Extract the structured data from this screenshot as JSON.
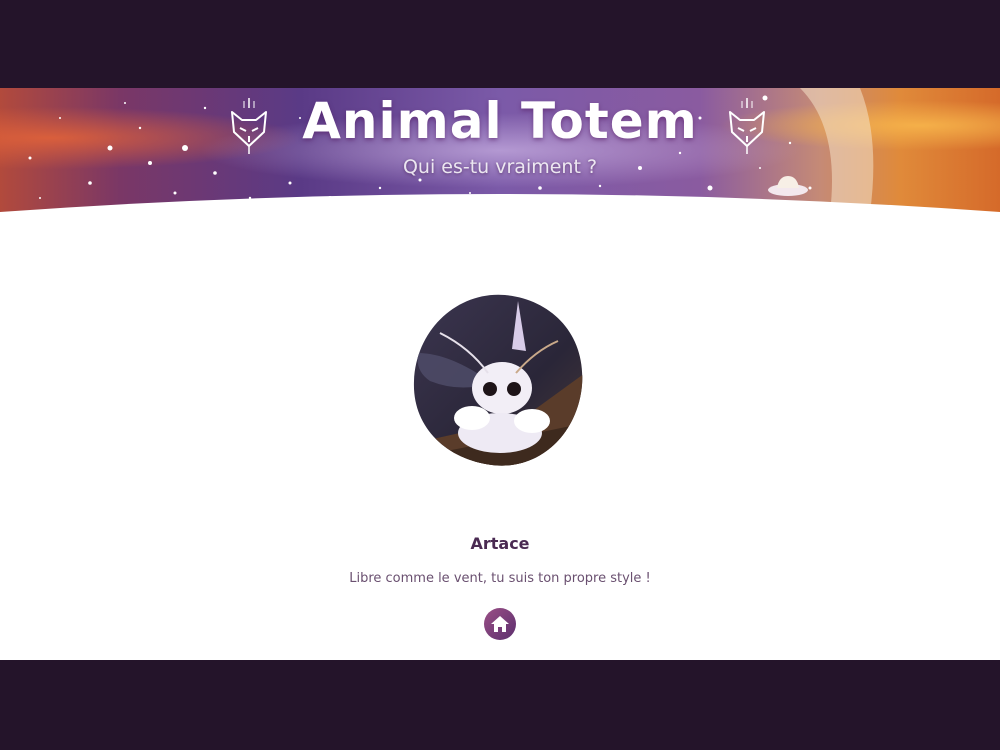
{
  "header": {
    "title": "Animal Totem",
    "subtitle": "Qui es-tu vraiment ?",
    "icons": [
      "totem-fox-icon",
      "totem-fox-icon",
      "ufo-icon"
    ]
  },
  "result": {
    "image": "moth-image",
    "name": "Artace",
    "description": "Libre comme le vent, tu suis ton propre style !"
  },
  "nav": {
    "home_icon": "home-icon"
  },
  "colors": {
    "page_background": "#24142a",
    "content_background": "#ffffff",
    "accent": "#7a3d7a",
    "name_text": "#4a2a52"
  }
}
